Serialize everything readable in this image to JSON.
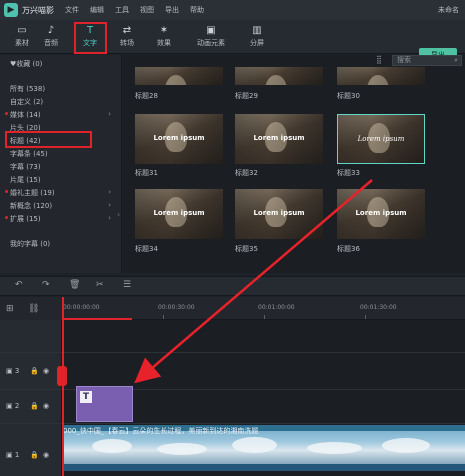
{
  "app": {
    "logo_glyph": "▶",
    "title": "万兴喵影",
    "window_title": "未命名"
  },
  "menu": {
    "items": [
      "文件",
      "编辑",
      "工具",
      "视图",
      "导出",
      "帮助"
    ]
  },
  "toolbar": {
    "tools": [
      {
        "label": "素材",
        "icon": "folder-icon",
        "glyph": "▭"
      },
      {
        "label": "音频",
        "icon": "music-icon",
        "glyph": "♪"
      },
      {
        "label": "文字",
        "icon": "text-icon",
        "glyph": "T"
      },
      {
        "label": "转场",
        "icon": "transition-icon",
        "glyph": "⇄"
      },
      {
        "label": "效果",
        "icon": "effects-icon",
        "glyph": "✶"
      },
      {
        "label": "动画元素",
        "icon": "elements-icon",
        "glyph": "▣"
      },
      {
        "label": "分屏",
        "icon": "split-screen-icon",
        "glyph": "▥"
      }
    ],
    "active_tool": "文字",
    "export_label": "导出"
  },
  "sidebar": {
    "favorites": "♥收藏 (0)",
    "items": [
      {
        "label": "所有 (538)",
        "marked": false,
        "expandable": false
      },
      {
        "label": "自定义 (2)",
        "marked": false,
        "expandable": false
      },
      {
        "label": "媒体 (14)",
        "marked": true,
        "expandable": true
      },
      {
        "label": "片头 (20)",
        "marked": false,
        "expandable": false
      },
      {
        "label": "标题 (42)",
        "marked": false,
        "expandable": false
      },
      {
        "label": "字幕条 (45)",
        "marked": false,
        "expandable": false
      },
      {
        "label": "字幕 (73)",
        "marked": false,
        "expandable": false
      },
      {
        "label": "片尾 (15)",
        "marked": false,
        "expandable": false
      },
      {
        "label": "婚礼主题 (19)",
        "marked": true,
        "expandable": true
      },
      {
        "label": "新概念 (120)",
        "marked": false,
        "expandable": true
      },
      {
        "label": "扩展 (15)",
        "marked": true,
        "expandable": true
      }
    ],
    "selected": "标题 (42)",
    "my_subtitles": "我的字幕 (0)"
  },
  "content": {
    "search_placeholder": "搜索",
    "top_labels": [
      "标题28",
      "标题29",
      "标题30"
    ],
    "rows": [
      [
        {
          "label": "标题31",
          "text": "Lorem ipsum"
        },
        {
          "label": "标题32",
          "text": "Lorem ipsum"
        },
        {
          "label": "标题33",
          "text": "Lorem ipsum"
        }
      ],
      [
        {
          "label": "标题34",
          "text": "Lorem ipsum"
        },
        {
          "label": "标题35",
          "text": "Lorem ipsum"
        },
        {
          "label": "标题36",
          "text": "Lorem ipsum"
        }
      ]
    ],
    "selected_item": "标题33"
  },
  "timeline": {
    "timecodes": [
      "00:00:00:00",
      "00:00:30:00",
      "00:01:00:00",
      "00:01:30:00"
    ],
    "tracks": [
      {
        "num": "3"
      },
      {
        "num": "2"
      },
      {
        "num": "1"
      }
    ],
    "video_clip_name": "000_快中国_【春云】云朵的生长过程，美丽新到达的湘南洗题"
  },
  "colors": {
    "accent": "#4fd1c5",
    "highlight_red": "#e0222a",
    "title_clip": "#7a5fb1"
  }
}
